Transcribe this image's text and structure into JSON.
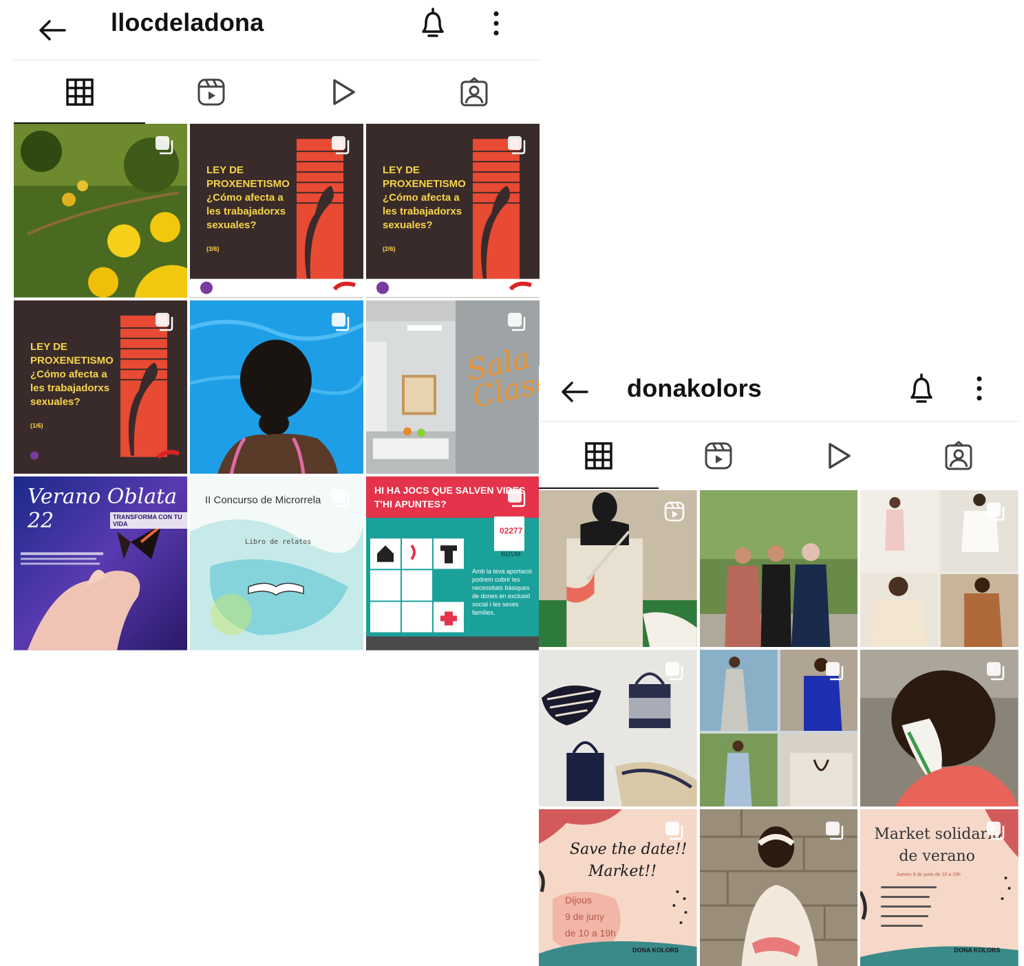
{
  "profiles": [
    {
      "username": "llocdeladona",
      "tiles": {
        "proxenetismo": {
          "title_line1": "LEY DE",
          "title_line2": "PROXENETISMO",
          "title_line3": "¿Cómo afecta a",
          "title_line4": "les trabajadorxs",
          "title_line5": "sexuales?"
        },
        "proxenetismo_pages": [
          "(3/6)",
          "(2/6)",
          "(1/6)"
        ],
        "sala_sign": "Sala Clase",
        "verano": {
          "title": "Verano Oblata 22",
          "subtitle": "TRANSFORMA CON TU VIDA"
        },
        "concurso": {
          "title": "II Concurso de Microrrela",
          "subtitle": "Libro de relatos"
        },
        "jocs": {
          "title_line1": "HI HA JOCS QUE SALVEN VIDES",
          "title_line2": "T'HI APUNTES?",
          "code": "02277",
          "bizum": "BIZUM",
          "body": "Amb la teva aportació podrem cobrir les necessitats bàsiques de dones en exclusió social i les seves famílies."
        }
      }
    },
    {
      "username": "donakolors",
      "tiles": {
        "save_date": {
          "line1": "Save the date!!",
          "line2": "Market!!",
          "line3": "Dijous",
          "line4": "9 de juny",
          "line5": "de 10 a 19h",
          "brand": "DONA KOLORS"
        },
        "market": {
          "line1": "Market solidario",
          "line2": "de verano",
          "line3": "Jueves 9 de junio de 10 a 19h",
          "brand": "DONA KOLORS"
        }
      }
    }
  ],
  "icons": {
    "back": "back-arrow-icon",
    "bell": "bell-icon",
    "more": "more-vertical-icon",
    "grid": "grid-icon",
    "reels": "reels-icon",
    "video": "play-icon",
    "tagged": "tagged-icon"
  },
  "colors": {
    "proxenetismo_bg": "#3a2b2b",
    "proxenetismo_red": "#e84a33",
    "proxenetismo_text": "#f7d54a",
    "jocs_red": "#e4334a",
    "jocs_teal": "#1aa19a",
    "pool_blue": "#1e9ee6",
    "save_peach": "#f6d8c8"
  }
}
